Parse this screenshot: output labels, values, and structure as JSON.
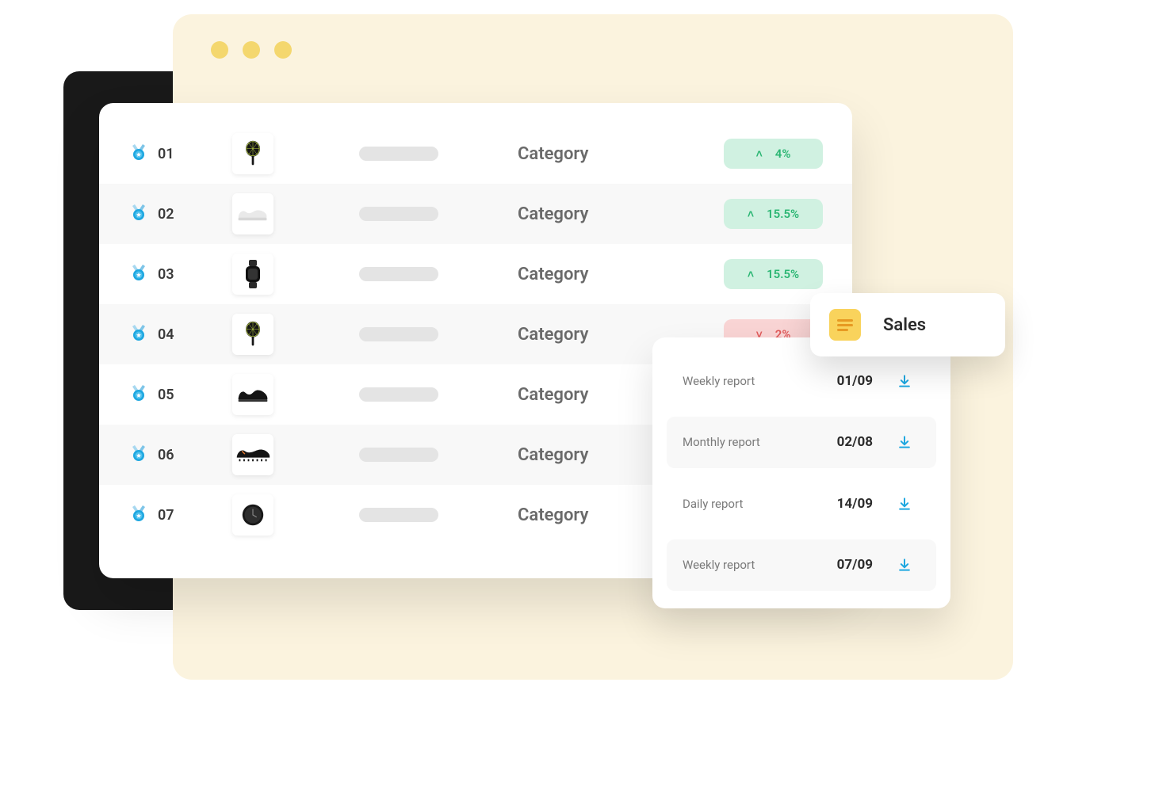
{
  "rows": [
    {
      "rank": "01",
      "category": "Category",
      "delta": "4%",
      "direction": "up",
      "product_icon": "racket"
    },
    {
      "rank": "02",
      "category": "Category",
      "delta": "15.5%",
      "direction": "up",
      "product_icon": "sneaker"
    },
    {
      "rank": "03",
      "category": "Category",
      "delta": "15.5%",
      "direction": "up",
      "product_icon": "watch"
    },
    {
      "rank": "04",
      "category": "Category",
      "delta": "2%",
      "direction": "down",
      "product_icon": "racket"
    },
    {
      "rank": "05",
      "category": "Category",
      "delta": "",
      "direction": "",
      "product_icon": "shoe"
    },
    {
      "rank": "06",
      "category": "Category",
      "delta": "",
      "direction": "",
      "product_icon": "cleat"
    },
    {
      "rank": "07",
      "category": "Category",
      "delta": "",
      "direction": "",
      "product_icon": "watch-round"
    }
  ],
  "reports_card": {
    "items": [
      {
        "name": "Weekly report",
        "date": "01/09"
      },
      {
        "name": "Monthly report",
        "date": "02/08"
      },
      {
        "name": "Daily report",
        "date": "14/09"
      },
      {
        "name": "Weekly report",
        "date": "07/09"
      }
    ]
  },
  "sales_chip": {
    "label": "Sales"
  }
}
